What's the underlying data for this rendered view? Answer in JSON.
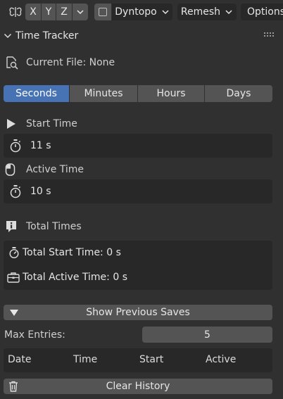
{
  "toolbar": {
    "axes": [
      "X",
      "Y",
      "Z"
    ],
    "dyntopo_label": "Dyntopo",
    "remesh_label": "Remesh",
    "options_label": "Options"
  },
  "panel": {
    "title": "Time Tracker"
  },
  "current_file": {
    "label": "Current File: None"
  },
  "units": {
    "tabs": [
      "Seconds",
      "Minutes",
      "Hours",
      "Days"
    ],
    "selected": "Seconds"
  },
  "start_time": {
    "label": "Start Time",
    "value": "11 s"
  },
  "active_time": {
    "label": "Active Time",
    "value": "10 s"
  },
  "total_times": {
    "label": "Total Times",
    "total_start": "Total Start Time: 0 s",
    "total_active": "Total Active Time: 0 s"
  },
  "history": {
    "show_saves_label": "Show Previous Saves",
    "max_entries_label": "Max Entries:",
    "max_entries_value": "5",
    "columns": [
      "Date",
      "Time",
      "Start",
      "Active"
    ],
    "clear_label": "Clear History"
  },
  "colors": {
    "background": "#303030",
    "field": "#282828",
    "button": "#545454",
    "accent": "#4772b3"
  }
}
